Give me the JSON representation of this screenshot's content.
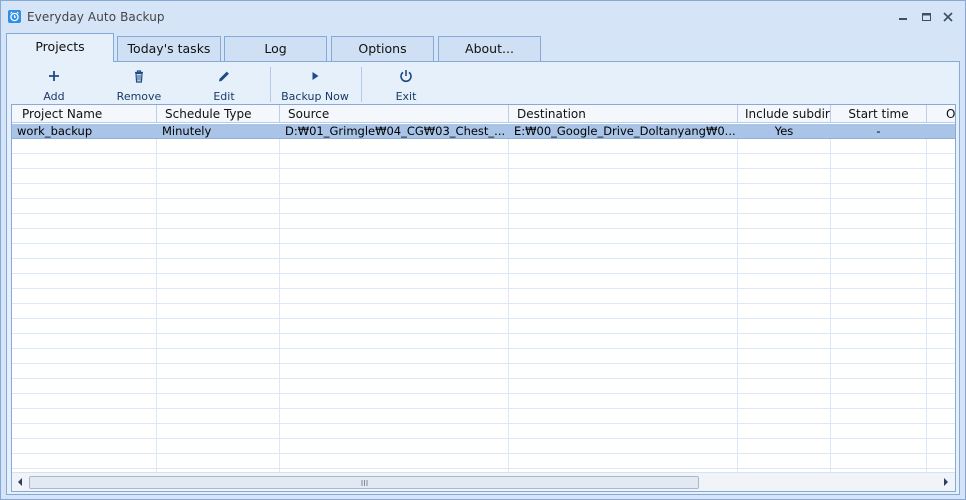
{
  "window": {
    "title": "Everyday Auto Backup"
  },
  "tabs": [
    {
      "label": "Projects",
      "active": true
    },
    {
      "label": "Today's tasks",
      "active": false
    },
    {
      "label": "Log",
      "active": false
    },
    {
      "label": "Options",
      "active": false
    },
    {
      "label": "About...",
      "active": false
    }
  ],
  "toolbar": {
    "add_label": "Add",
    "remove_label": "Remove",
    "edit_label": "Edit",
    "backup_now_label": "Backup Now",
    "exit_label": "Exit"
  },
  "table": {
    "columns": [
      "Project Name",
      "Schedule Type",
      "Source",
      "Destination",
      "Include subdir",
      "Start time",
      "O"
    ],
    "rows": [
      {
        "project_name": "work_backup",
        "schedule_type": "Minutely",
        "source": "D:₩01_Grimgle₩04_CG₩03_Chest_...",
        "destination": "E:₩00_Google_Drive_Doltanyang₩0...",
        "include_subdir": "Yes",
        "start_time": "-"
      }
    ]
  },
  "colors": {
    "accent": "#2f8fe6",
    "selection": "#a9c4e6",
    "frame": "#d5e5f7",
    "border": "#86a9d6"
  }
}
